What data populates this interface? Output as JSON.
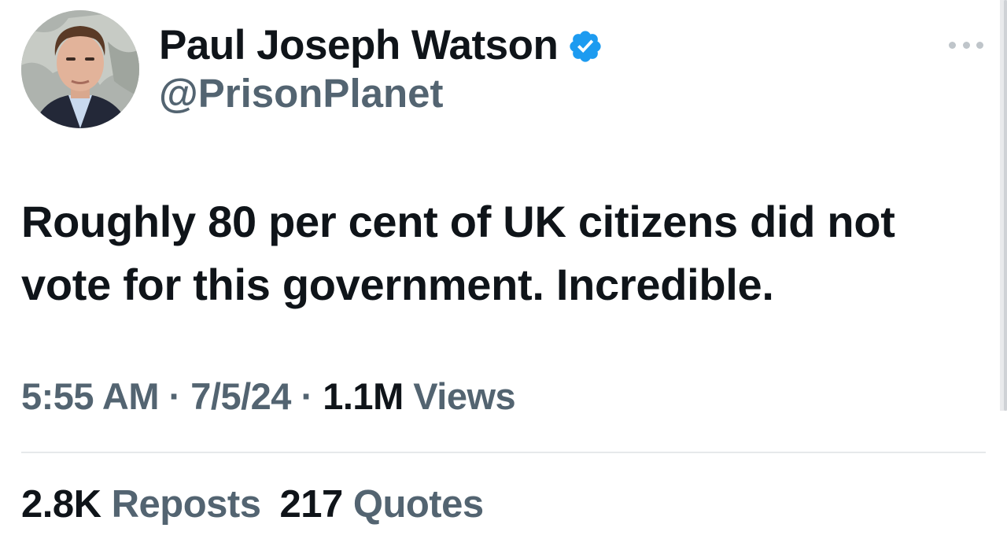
{
  "author": {
    "display_name": "Paul Joseph Watson",
    "handle": "@PrisonPlanet",
    "verified": true,
    "verified_color": "#1d9bf0"
  },
  "tweet": {
    "text": "Roughly 80 per cent of UK citizens did not vote for this government. Incredible.",
    "time": "5:55 AM",
    "separator": " · ",
    "date": "7/5/24",
    "views_count": "1.1M",
    "views_label": " Views"
  },
  "stats": {
    "reposts_count": "2.8K",
    "reposts_label": " Reposts",
    "quotes_count": "217",
    "quotes_label": " Quotes"
  },
  "icons": {
    "more": "more-horizontal-icon",
    "verified": "verified-badge-icon"
  },
  "colors": {
    "text_primary": "#0f1419",
    "text_secondary": "#536471",
    "divider": "#e6e9eb"
  }
}
